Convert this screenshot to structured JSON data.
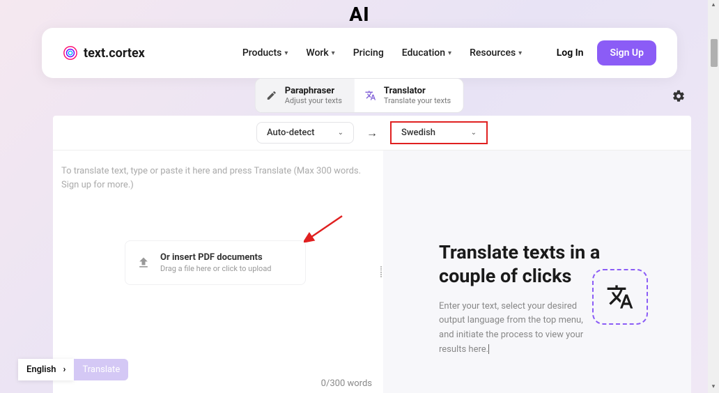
{
  "top": {
    "partial_text": "AI"
  },
  "header": {
    "brand": "text.cortex",
    "nav": {
      "products": "Products",
      "work": "Work",
      "pricing": "Pricing",
      "education": "Education",
      "resources": "Resources"
    },
    "login": "Log In",
    "signup": "Sign Up"
  },
  "mode_tabs": {
    "paraphraser": {
      "title": "Paraphraser",
      "subtitle": "Adjust your texts"
    },
    "translator": {
      "title": "Translator",
      "subtitle": "Translate your texts"
    }
  },
  "lang_bar": {
    "source": "Auto-detect",
    "target": "Swedish"
  },
  "input_area": {
    "placeholder": "To translate text, type or paste it here and press Translate (Max 300 words. Sign up for more.)",
    "pdf_title": "Or insert PDF documents",
    "pdf_subtitle": "Drag a file here or click to upload",
    "word_counter": "0/300 words"
  },
  "output_area": {
    "heading": "Translate texts in a couple of clicks",
    "description": "Enter your text, select your desired output language from the top menu, and initiate the process to view your results here."
  },
  "bottom": {
    "language": "English",
    "translate_button": "Translate"
  }
}
